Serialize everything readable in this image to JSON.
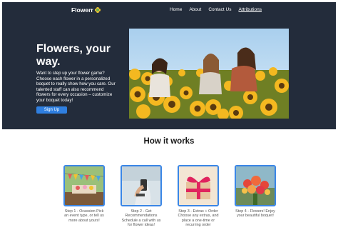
{
  "nav": {
    "logo": "Flowerr",
    "links": [
      "Home",
      "About",
      "Contact Us",
      "Attributions"
    ]
  },
  "hero": {
    "title": "Flowers, your way.",
    "text": "Want to step up your flower game? Choose each flower in a personalized boquet to really show how you care. Our talented staff can also recommend flowers for every occasion – customize your boquet today!",
    "button": "Sign Up"
  },
  "how": {
    "title": "How it works",
    "steps": [
      {
        "caption": "Step 1 - Ocassion Pick an event type, or tell us more about yours!",
        "icon": "party-bunting-image"
      },
      {
        "caption": "Step 2 - Get Recommendations Schedule a call with us for flower ideas!",
        "icon": "phone-call-image"
      },
      {
        "caption": "Step 3 - Extras + Order Choose any extras, and place a one-time or recurring order",
        "icon": "gift-box-image"
      },
      {
        "caption": "Step 4 - Flowers! Enjoy your beautiful boquet!",
        "icon": "bouquet-image"
      }
    ]
  },
  "colors": {
    "hero_bg": "#232c3b",
    "accent": "#2f7fe0",
    "step_border": "#3a86e6"
  }
}
